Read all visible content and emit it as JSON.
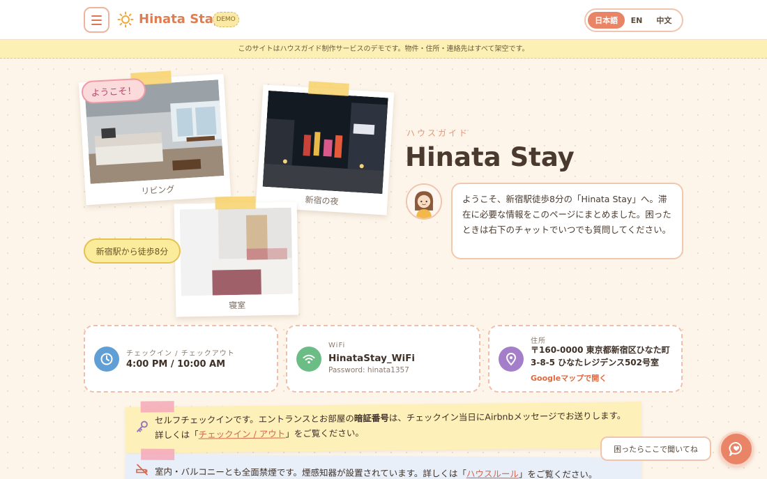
{
  "header": {
    "brand": "Hinata Stay",
    "demo_badge": "DEMO",
    "languages": [
      "日本語",
      "EN",
      "中文"
    ],
    "active_language": "日本語"
  },
  "banner": "このサイトはハウスガイド制作サービスのデモです。物件・住所・連絡先はすべて架空です。",
  "photos": {
    "living": "リビング",
    "night": "新宿の夜",
    "bedroom": "寝室"
  },
  "stickers": {
    "welcome": "ようこそ！",
    "walk": "新宿駅から徒歩8分"
  },
  "hero": {
    "eyebrow": "ハウスガイド",
    "title": "Hinata Stay",
    "message": "ようこそ、新宿駅徒歩8分の「Hinata Stay」へ。滞在に必要な情報をこのページにまとめました。困ったときは右下のチャットでいつでも質問してください。"
  },
  "cards": {
    "checkin": {
      "label": "チェックイン / チェックアウト",
      "value": "4:00 PM / 10:00 AM"
    },
    "wifi": {
      "label": "WiFi",
      "ssid": "HinataStay_WiFi",
      "password": "Password: hinata1357"
    },
    "address": {
      "label": "住所",
      "value": "〒160-0000 東京都新宿区ひなた町3-8-5 ひなたレジデンス502号室",
      "map_link": "Googleマップで開く"
    }
  },
  "notes": {
    "checkin": {
      "pre": "セルフチェックインです。エントランスとお部屋の",
      "bold": "暗証番号",
      "mid": "は、チェックイン当日にAirbnbメッセージでお送りします。詳しくは「",
      "link": "チェックイン / アウト",
      "post": "」をご覧ください。"
    },
    "smoking": {
      "pre": "室内・バルコニーとも全面禁煙です。煙感知器が設置されています。詳しくは「",
      "link": "ハウスルール",
      "post": "」をご覧ください。"
    }
  },
  "chat": {
    "hint": "困ったらここで聞いてね"
  },
  "colors": {
    "accent": "#ea8466",
    "brand": "#e07c4e",
    "banner": "#fdf0b5"
  }
}
